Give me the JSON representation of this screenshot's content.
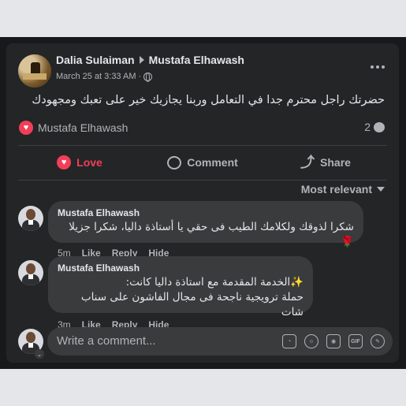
{
  "post": {
    "author": "Dalia Sulaiman",
    "target": "Mustafa Elhawash",
    "timestamp": "March 25 at 3:33 AM",
    "separator": "·",
    "text": "حضرتك راجل محترم جدا في التعامل وربنا يجازيك خير على تعبك ومجهودك",
    "reaction_name": "Mustafa Elhawash",
    "comment_count": "2"
  },
  "actions": {
    "love": "Love",
    "comment": "Comment",
    "share": "Share"
  },
  "sort_label": "Most relevant",
  "comments": [
    {
      "name": "Mustafa Elhawash",
      "text": "شكرا لذوقك ولكلامك الطيب فى حقي يا أستاذة داليا، شكرا جزيلا🌹",
      "time": "5m",
      "like": "Like",
      "reply": "Reply",
      "hide": "Hide"
    },
    {
      "name": "Mustafa Elhawash",
      "line1": "✨الخدمة المقدمة مع استاذة داليا كانت:",
      "line2": "حملة ترويجية ناجحة فى مجال الفاشون على سناب شات",
      "time": "3m",
      "like": "Like",
      "reply": "Reply",
      "hide": "Hide"
    }
  ],
  "composer": {
    "placeholder": "Write a comment...",
    "icons": [
      "sticker-icon",
      "emoji-icon",
      "camera-icon",
      "gif-icon",
      "avatar-sticker-icon"
    ],
    "gif_label": "GIF"
  },
  "colors": {
    "background": "#242526",
    "bubble": "#3a3b3c",
    "love": "#f33e58",
    "text": "#e4e6eb",
    "secondary": "#b0b3b8"
  }
}
